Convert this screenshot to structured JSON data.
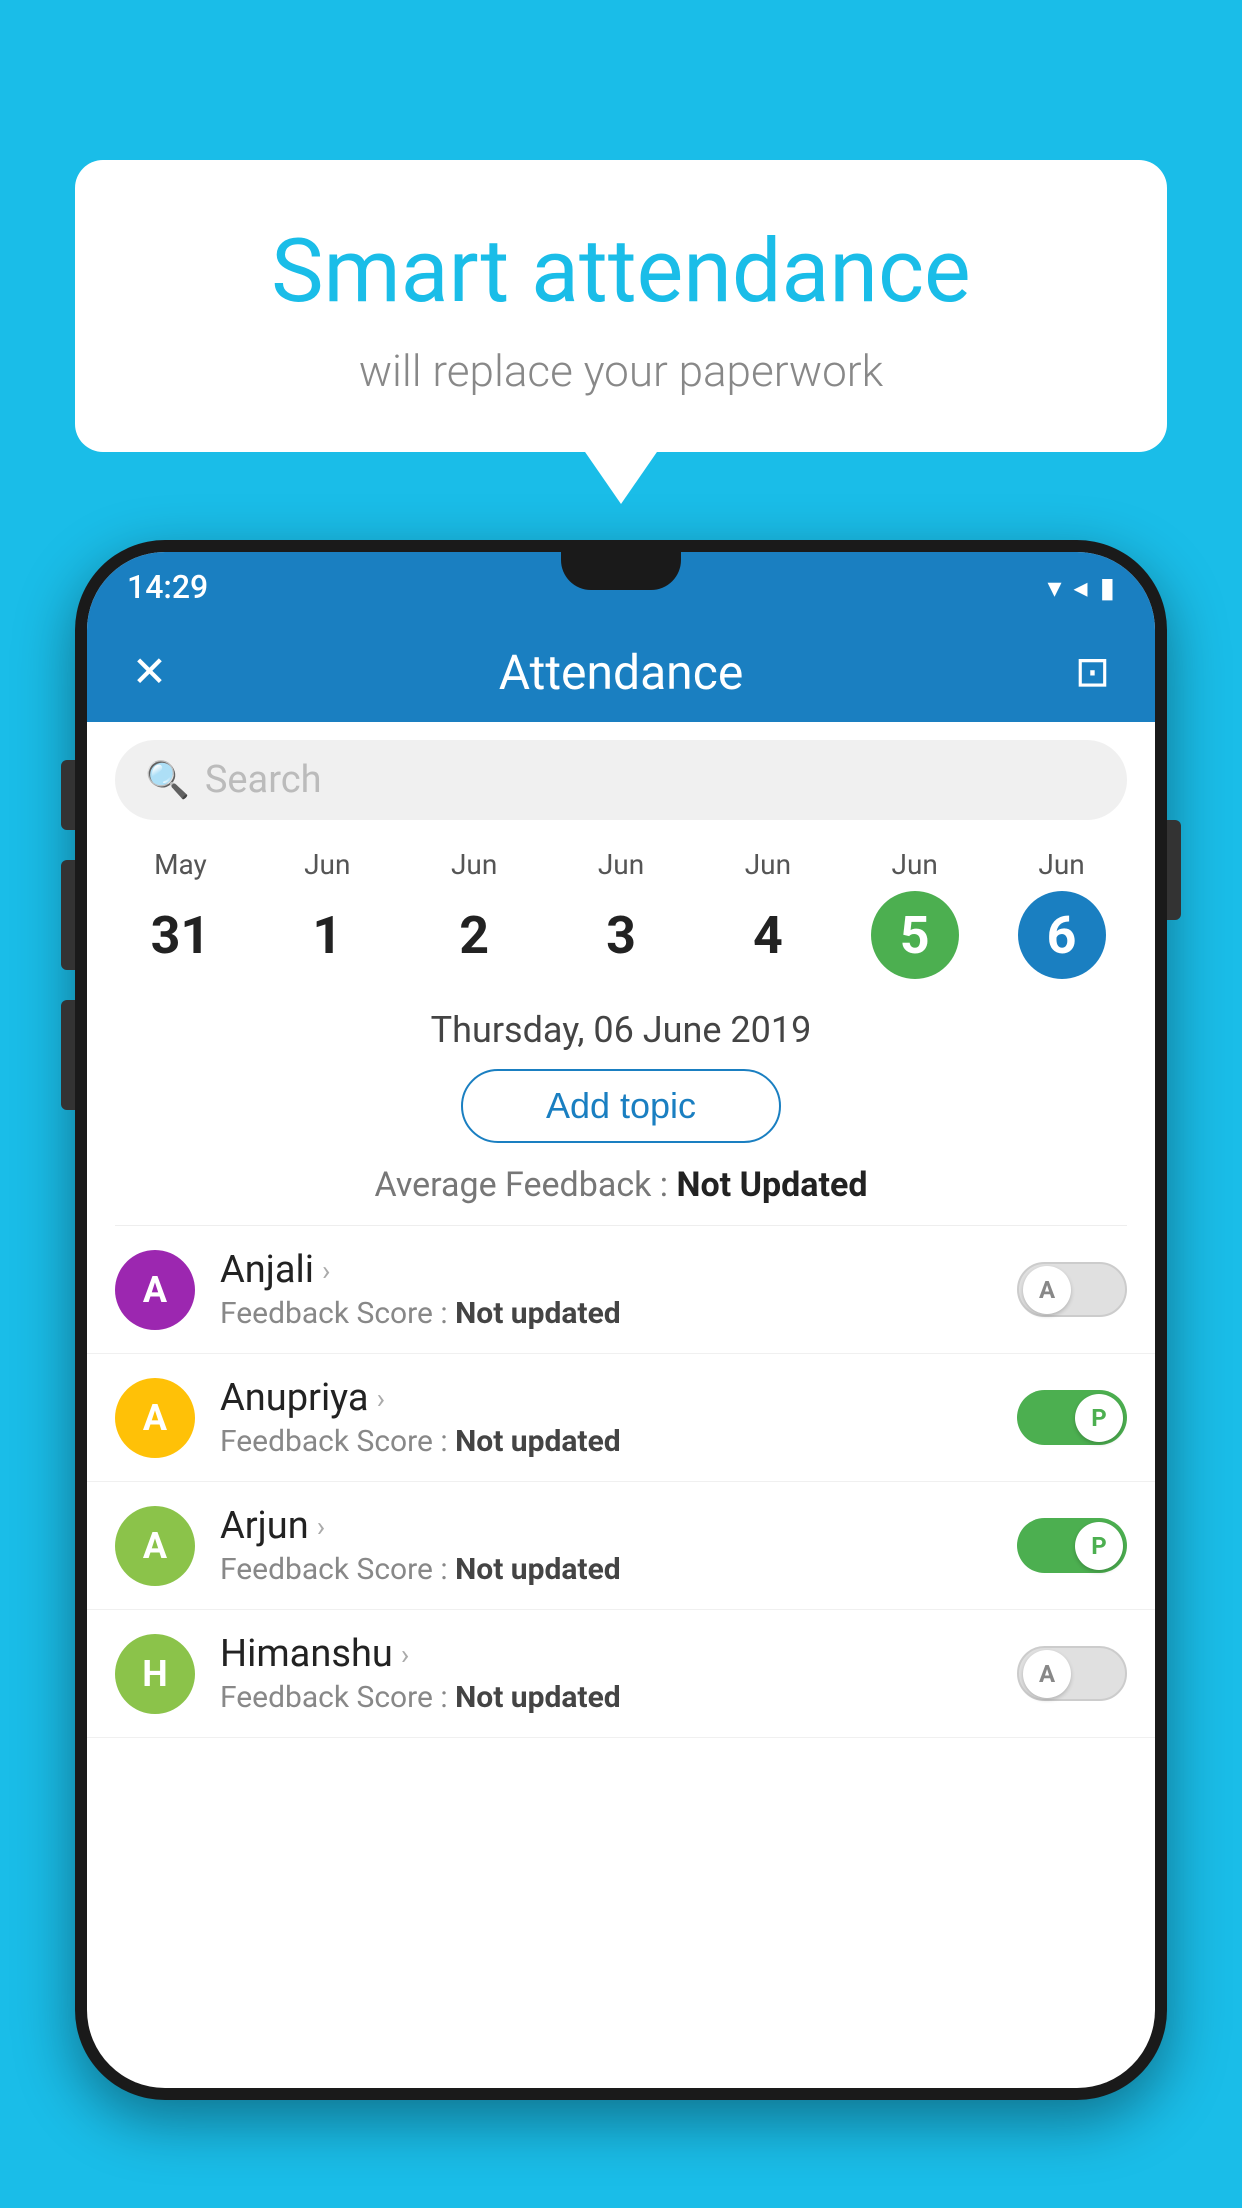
{
  "background_color": "#1ABDE8",
  "speech_bubble": {
    "title": "Smart attendance",
    "subtitle": "will replace your paperwork"
  },
  "phone": {
    "status_bar": {
      "time": "14:29",
      "signal_icon": "▾◂🔋"
    },
    "app_bar": {
      "close_icon": "✕",
      "title": "Attendance",
      "calendar_icon": "📅"
    },
    "search": {
      "placeholder": "Search"
    },
    "calendar": {
      "days": [
        {
          "month": "May",
          "date": "31",
          "style": "normal"
        },
        {
          "month": "Jun",
          "date": "1",
          "style": "normal"
        },
        {
          "month": "Jun",
          "date": "2",
          "style": "normal"
        },
        {
          "month": "Jun",
          "date": "3",
          "style": "normal"
        },
        {
          "month": "Jun",
          "date": "4",
          "style": "normal"
        },
        {
          "month": "Jun",
          "date": "5",
          "style": "today"
        },
        {
          "month": "Jun",
          "date": "6",
          "style": "selected"
        }
      ]
    },
    "selected_date_label": "Thursday, 06 June 2019",
    "add_topic_label": "Add topic",
    "avg_feedback_label": "Average Feedback :",
    "avg_feedback_value": "Not Updated",
    "students": [
      {
        "name": "Anjali",
        "avatar_letter": "A",
        "avatar_color": "#9C27B0",
        "feedback_label": "Feedback Score :",
        "feedback_value": "Not updated",
        "toggle_state": "off",
        "toggle_label": "A"
      },
      {
        "name": "Anupriya",
        "avatar_letter": "A",
        "avatar_color": "#FFC107",
        "feedback_label": "Feedback Score :",
        "feedback_value": "Not updated",
        "toggle_state": "on",
        "toggle_label": "P"
      },
      {
        "name": "Arjun",
        "avatar_letter": "A",
        "avatar_color": "#8BC34A",
        "feedback_label": "Feedback Score :",
        "feedback_value": "Not updated",
        "toggle_state": "on",
        "toggle_label": "P"
      },
      {
        "name": "Himanshu",
        "avatar_letter": "H",
        "avatar_color": "#8BC34A",
        "feedback_label": "Feedback Score :",
        "feedback_value": "Not updated",
        "toggle_state": "off",
        "toggle_label": "A"
      }
    ]
  }
}
